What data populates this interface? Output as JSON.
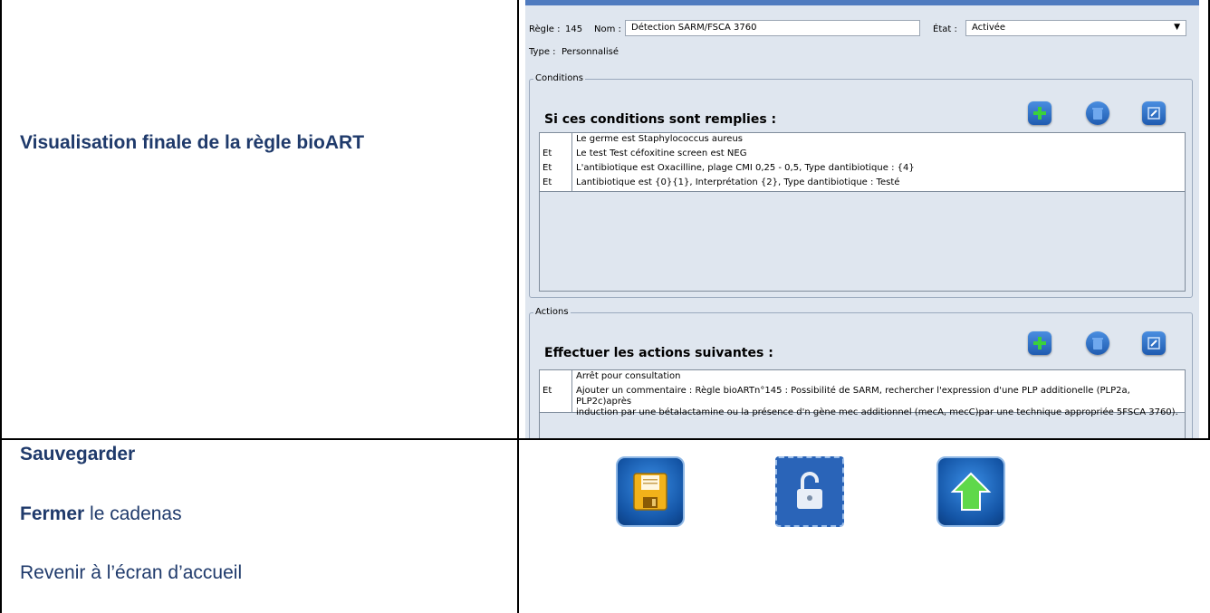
{
  "left": {
    "title": "Visualisation finale de la règle bioART",
    "steps": {
      "save_bold": "Sauvegarder",
      "close_bold": "Fermer",
      "close_rest": " le cadenas",
      "home": "Revenir à l’écran d’accueil"
    }
  },
  "app": {
    "regle_label": "Règle :",
    "regle_value": "145",
    "nom_label": "Nom :",
    "nom_value": "Détection SARM/FSCA 3760",
    "etat_label": "État :",
    "etat_value": "Activée",
    "type_label": "Type :",
    "type_value": "Personnalisé",
    "conditions": {
      "legend": "Conditions",
      "heading": "Si ces conditions sont remplies :",
      "rows": [
        {
          "conn": "",
          "text": "Le germe est Staphylococcus aureus"
        },
        {
          "conn": "Et",
          "text": "Le test Test céfoxitine screen est NEG"
        },
        {
          "conn": "Et",
          "text": "L'antibiotique est Oxacilline, plage CMI 0,25 - 0,5, Type dantibiotique : {4}"
        },
        {
          "conn": "Et",
          "text": "Lantibiotique est {0}{1}, Interprétation {2}, Type dantibiotique : Testé"
        }
      ]
    },
    "actions": {
      "legend": "Actions",
      "heading": "Effectuer les actions suivantes :",
      "rows": [
        {
          "conn": "",
          "text": "Arrêt pour consultation"
        },
        {
          "conn": "Et",
          "text": "Ajouter un commentaire : Règle bioARTn°145 : Possibilité de SARM, rechercher l'expression d'une PLP additionelle (PLP2a, PLP2c)après\ninduction par une bétalactamine ou la présence d'n gène mec additionnel (mecA, mecC)par une technique appropriée 5FSCA 3760)."
        }
      ]
    }
  },
  "icons": {
    "add": "add-icon",
    "delete": "trash-icon",
    "edit": "edit-icon",
    "save": "floppy-disk-icon",
    "lock": "unlocked-padlock-icon",
    "home": "home-arrow-icon"
  }
}
